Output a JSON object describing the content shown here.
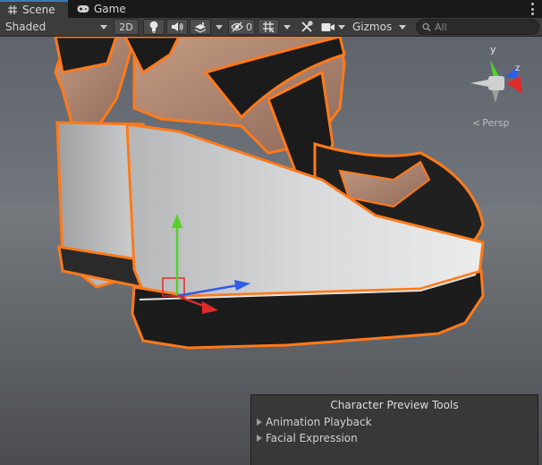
{
  "tabs": [
    {
      "label": "Scene",
      "icon": "grid-hash-icon",
      "active": true
    },
    {
      "label": "Game",
      "icon": "gamepad-icon",
      "active": false
    }
  ],
  "toolbar": {
    "shading_mode": "Shaded",
    "mode_2d_label": "2D",
    "hidden_count": "0",
    "gizmos_label": "Gizmos",
    "search_placeholder": "All"
  },
  "orientation_gizmo": {
    "axis_y": "y",
    "axis_z": "z",
    "projection_label": "Persp"
  },
  "overlay_panel": {
    "title": "Character Preview Tools",
    "items": [
      {
        "label": "Animation Playback"
      },
      {
        "label": "Facial Expression"
      }
    ]
  },
  "colors": {
    "selection_outline": "#ff7a1a",
    "axis_x": "#e02a2a",
    "axis_y": "#55d12a",
    "axis_z": "#2f5ce8",
    "tab_accent": "#3a79bb"
  }
}
